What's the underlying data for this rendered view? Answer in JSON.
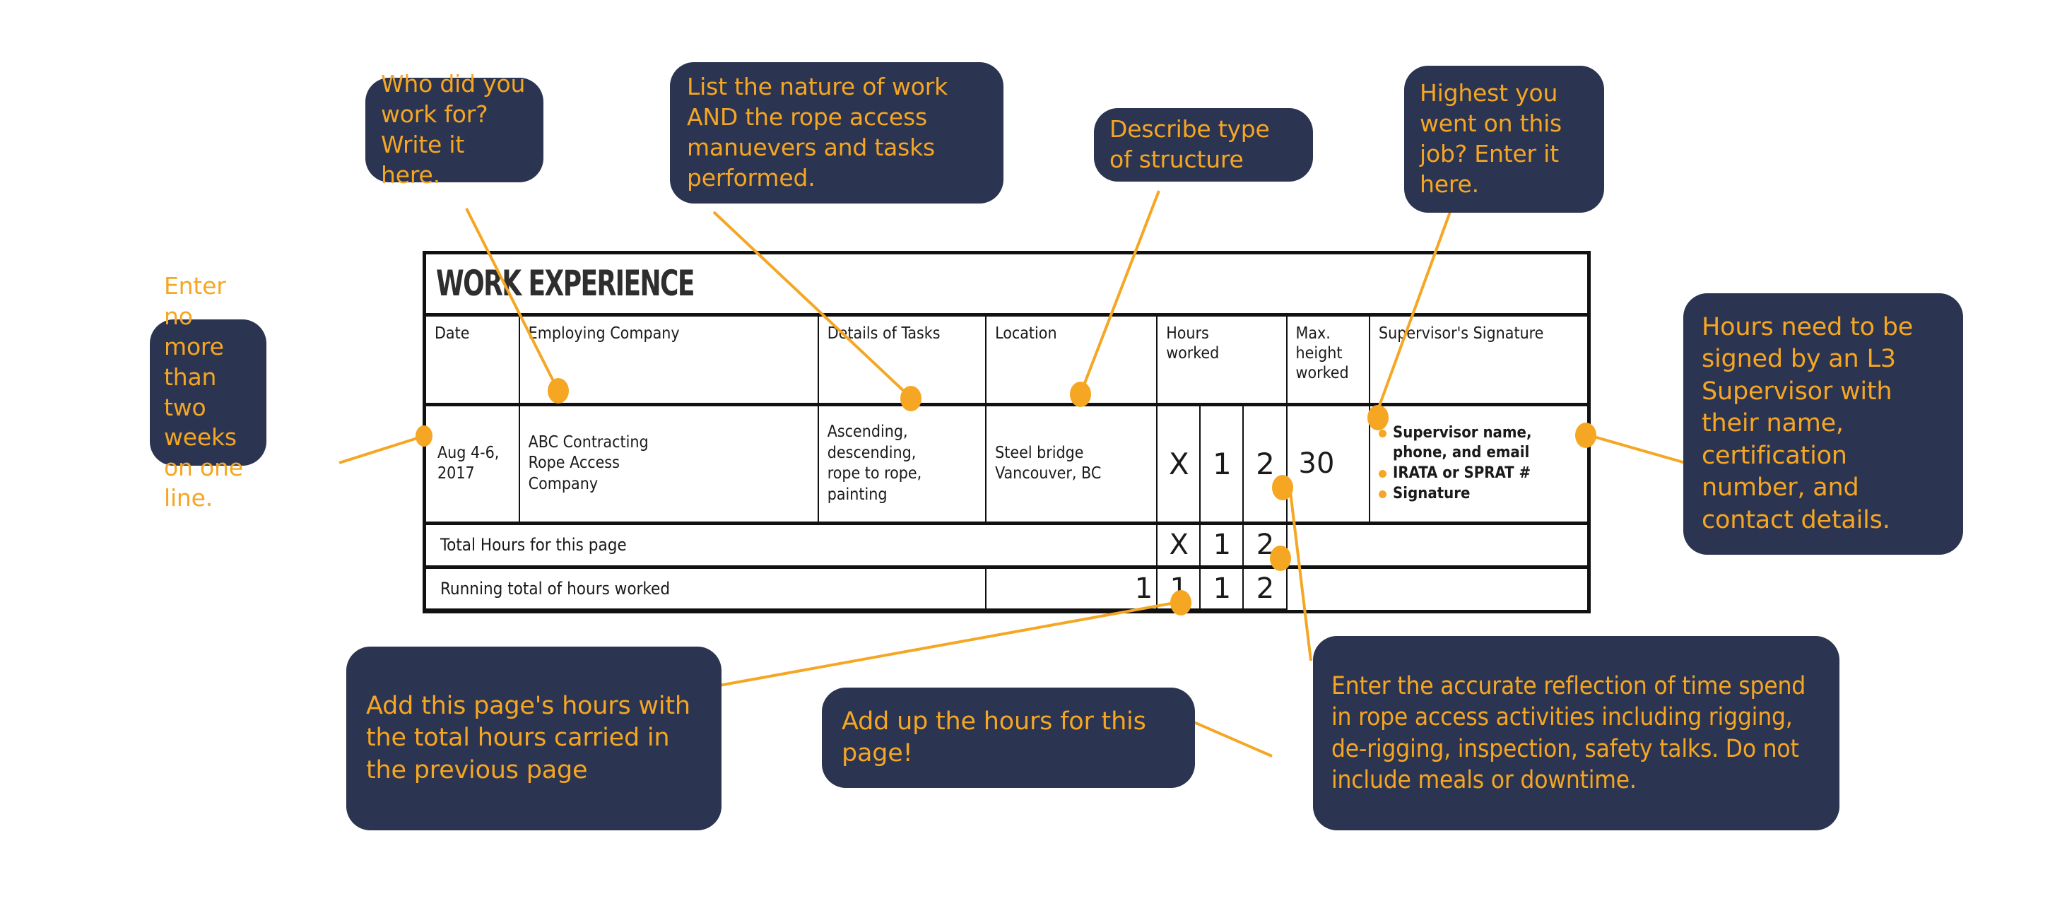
{
  "doc": {
    "title": "WORK EXPERIENCE"
  },
  "table": {
    "headers": {
      "date": "Date",
      "company": "Employing Company",
      "tasks": "Details of Tasks",
      "location": "Location",
      "hours": "Hours\nworked",
      "hours_line1": "Hours",
      "hours_line2": "worked",
      "max_height": "Max. height\nworked",
      "max_height_line1": "Max. height",
      "max_height_line2": "worked",
      "supervisor": "Supervisor's Signature"
    },
    "rows": [
      {
        "date": "Aug 4-6,\n2017",
        "date_line1": "Aug 4-6,",
        "date_line2": "2017",
        "company_line1": "ABC Contracting",
        "company_line2": "Rope Access",
        "company_line3": "Company",
        "tasks_line1": "Ascending, descending,",
        "tasks_line2": "rope to rope, painting",
        "location_line1": "Steel bridge",
        "location_line2": "Vancouver, BC",
        "hours_digit_1": "X",
        "hours_digit_2": "1",
        "hours_digit_3": "2",
        "max_height": "30",
        "supervisor_bullets": [
          "Supervisor name, phone, and email",
          "IRATA or SPRAT #",
          "Signature"
        ]
      }
    ],
    "total_row": {
      "label": "Total Hours for this page",
      "digit_0": "",
      "digit_1": "X",
      "digit_2": "1",
      "digit_3": "2"
    },
    "running_row": {
      "label": "Running total of hours worked",
      "digit_0": "1",
      "digit_1": "1",
      "digit_2": "1",
      "digit_3": "2"
    }
  },
  "callouts": {
    "two_weeks": "Enter no more than two weeks on one line.",
    "who_work_for": "Who did you work for? Write it here.",
    "nature_of_work": "List the nature of work AND the rope access manuevers and tasks performed.",
    "type_structure": "Describe type of structure",
    "highest": "Highest you went on this job? Enter it here.",
    "signed_l3": "Hours need to be signed by an L3 Supervisor with their name, certification number, and contact details.",
    "add_page_hours": "Add this page's hours with the total hours carried in the previous page",
    "add_up_hours": "Add up the hours for this page!",
    "accurate_reflection": "Enter the accurate reflection of time spend in rope access activities including rigging, de-rigging, inspection, safety talks. Do not include meals or downtime."
  },
  "colors": {
    "callout_bg": "#2b3450",
    "callout_text": "#f5a623",
    "accent_dot": "#f5a623",
    "table_border": "#111111",
    "page_bg": "#ffffff",
    "heading_text": "#2e2e2e"
  }
}
